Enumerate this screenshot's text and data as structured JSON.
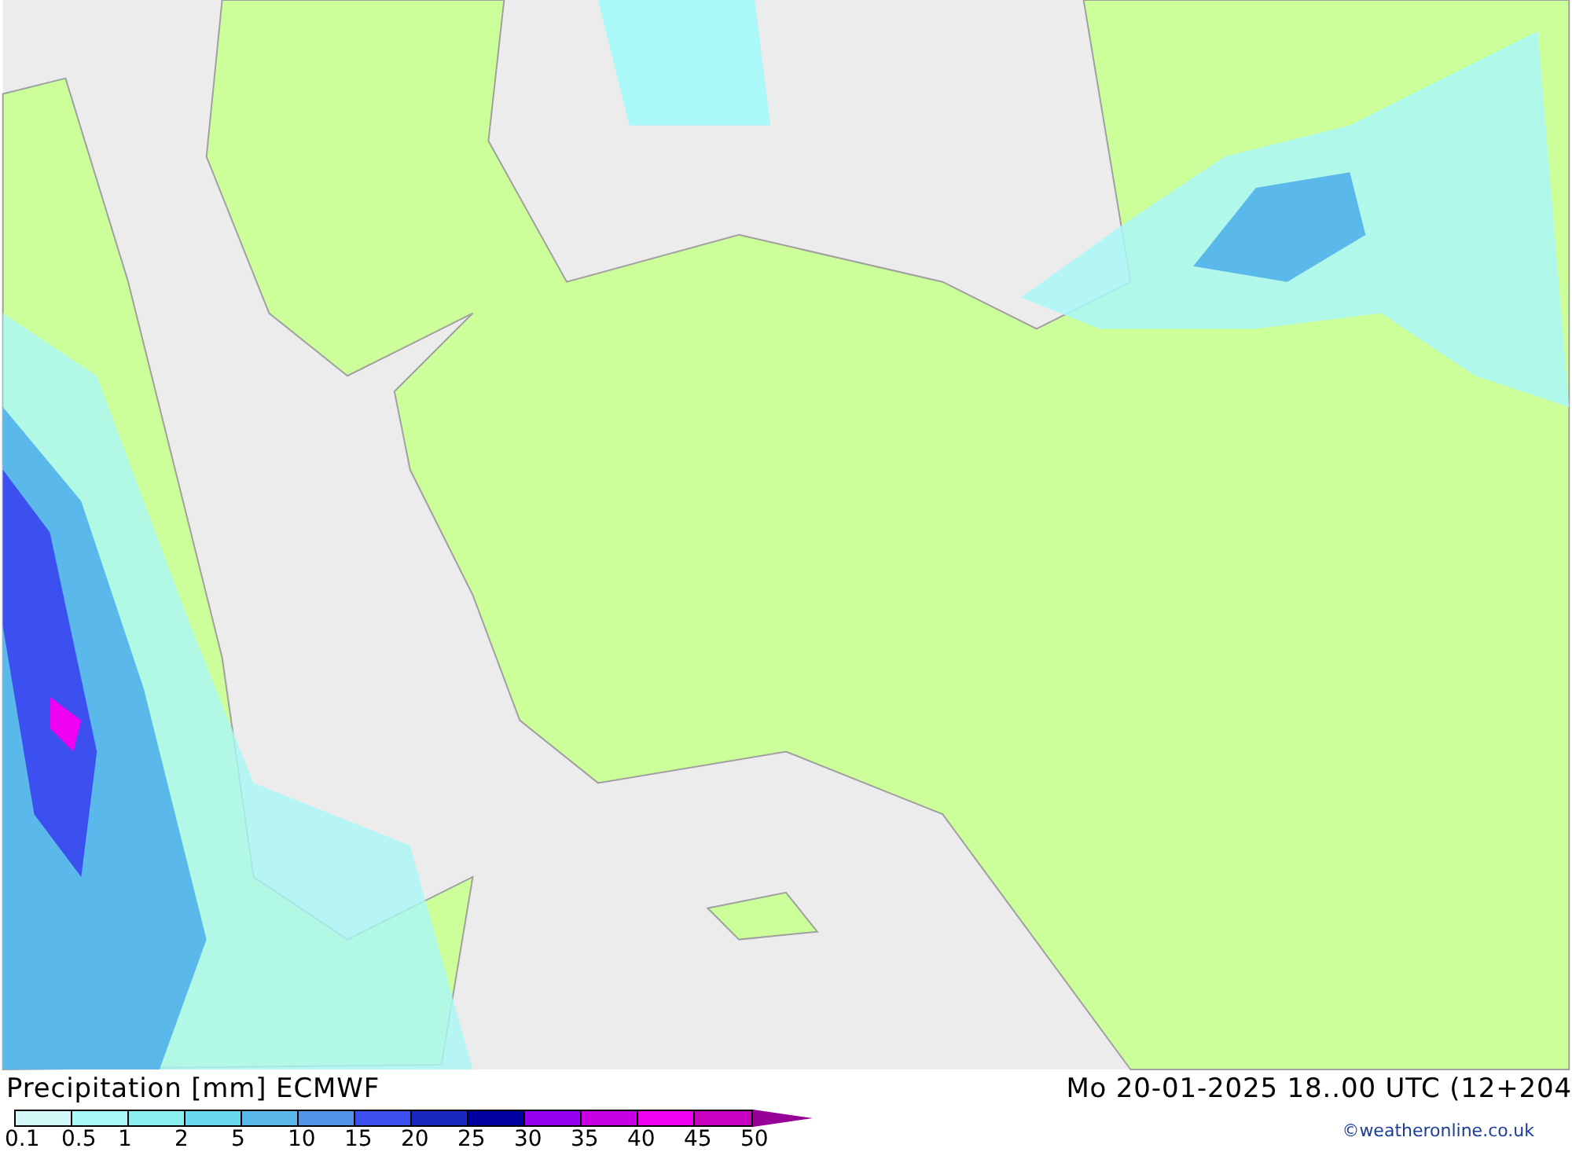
{
  "legend": {
    "title": "Precipitation [mm]",
    "model": "ECMWF",
    "swatches": [
      {
        "color": "#d2f8f8"
      },
      {
        "color": "#a8f8f8"
      },
      {
        "color": "#8ceeee"
      },
      {
        "color": "#6ad8ee"
      },
      {
        "color": "#5ab8ea"
      },
      {
        "color": "#5494e8"
      },
      {
        "color": "#3c50f0"
      },
      {
        "color": "#1a28c0"
      },
      {
        "color": "#0000a0"
      },
      {
        "color": "#9600f0"
      },
      {
        "color": "#c800e6"
      },
      {
        "color": "#f000f0"
      },
      {
        "color": "#c800c0"
      },
      {
        "color": "#960096",
        "kind": "arrow"
      }
    ],
    "labels": [
      "0.1",
      "0.5",
      "1",
      "2",
      "5",
      "10",
      "15",
      "20",
      "25",
      "30",
      "35",
      "40",
      "45",
      "50"
    ]
  },
  "valid_time": "Mo 20-01-2025 18..00 UTC (12+204",
  "credit": "©weatheronline.co.uk"
}
